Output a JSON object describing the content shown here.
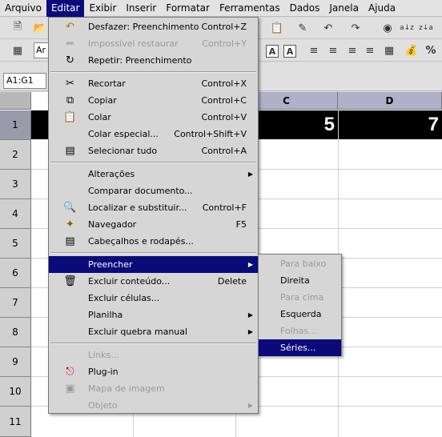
{
  "menubar": [
    "Arquivo",
    "Editar",
    "Exibir",
    "Inserir",
    "Formatar",
    "Ferramentas",
    "Dados",
    "Janela",
    "Ajuda"
  ],
  "toolbar": {
    "font_name": "Ar",
    "icons": [
      "new-icon",
      "open-icon",
      "paste-icon",
      "format-paintbrush-icon",
      "undo-icon",
      "redo-icon",
      "navigator-icon",
      "sort-ascending-icon",
      "sort-descending-icon",
      "percent-icon"
    ]
  },
  "name_box": "A1:G1",
  "sheet": {
    "columns": [
      "C",
      "D"
    ],
    "rows": [
      "1",
      "2",
      "3",
      "4",
      "5",
      "6",
      "7",
      "8",
      "9",
      "10",
      "11"
    ],
    "cell_values": [
      "5",
      "7"
    ]
  },
  "edit_menu": [
    {
      "label": "Desfazer: Preenchimento",
      "shortcut": "Control+Z"
    },
    {
      "label": "Impossível restaurar",
      "shortcut": "Control+Y"
    },
    {
      "label": "Repetir: Preenchimento",
      "shortcut": ""
    },
    {
      "label": "Recortar",
      "shortcut": "Control+X"
    },
    {
      "label": "Copiar",
      "shortcut": "Control+C"
    },
    {
      "label": "Colar",
      "shortcut": "Control+V"
    },
    {
      "label": "Colar especial...",
      "shortcut": "Control+Shift+V"
    },
    {
      "label": "Selecionar tudo",
      "shortcut": "Control+A"
    },
    {
      "label": "Alterações",
      "shortcut": ""
    },
    {
      "label": "Comparar documento...",
      "shortcut": ""
    },
    {
      "label": "Localizar e substituir...",
      "shortcut": "Control+F"
    },
    {
      "label": "Navegador",
      "shortcut": "F5"
    },
    {
      "label": "Cabeçalhos e rodapés...",
      "shortcut": ""
    },
    {
      "label": "Preencher",
      "shortcut": ""
    },
    {
      "label": "Excluir conteúdo...",
      "shortcut": "Delete"
    },
    {
      "label": "Excluir células...",
      "shortcut": ""
    },
    {
      "label": "Planilha",
      "shortcut": ""
    },
    {
      "label": "Excluir quebra manual",
      "shortcut": ""
    },
    {
      "label": "Links...",
      "shortcut": ""
    },
    {
      "label": "Plug-in",
      "shortcut": ""
    },
    {
      "label": "Mapa de imagem",
      "shortcut": ""
    },
    {
      "label": "Objeto",
      "shortcut": ""
    }
  ],
  "fill_submenu": [
    "Para baixo",
    "Direita",
    "Para cima",
    "Esquerda",
    "Folhas...",
    "Séries..."
  ]
}
